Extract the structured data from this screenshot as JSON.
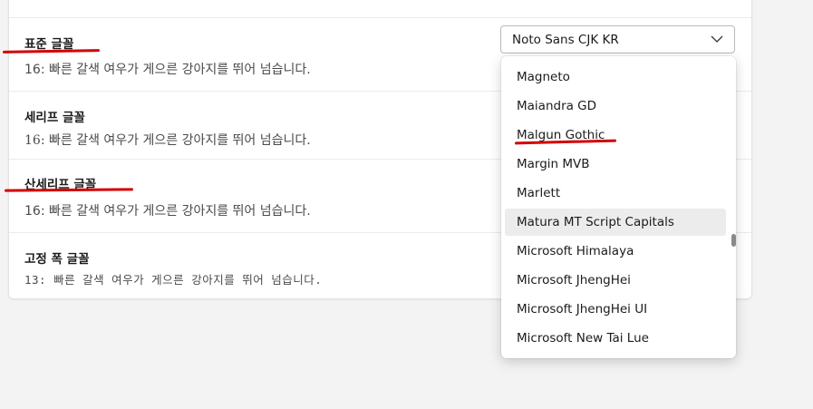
{
  "rows": [
    {
      "label": "표준 글꼴",
      "sample": "16: 빠른 갈색 여우가 게으른 강아지를 뛰어 넘습니다."
    },
    {
      "label": "세리프 글꼴",
      "sample": "16: 빠른 갈색 여우가 게으른 강아지를 뛰어 넘습니다."
    },
    {
      "label": "산세리프 글꼴",
      "sample": "16: 빠른 갈색 여우가 게으른 강아지를 뛰어 넘습니다."
    },
    {
      "label": "고정 폭 글꼴",
      "sample": "13: 빠른 갈색 여우가 게으른 강아지를 뛰어 넘습니다."
    }
  ],
  "font_select": {
    "selected": "Noto Sans CJK KR",
    "icon": "chevron-down-icon"
  },
  "dropdown": {
    "options": [
      "Magneto",
      "Maiandra GD",
      "Malgun Gothic",
      "Margin MVB",
      "Marlett",
      "Matura MT Script Capitals",
      "Microsoft Himalaya",
      "Microsoft JhengHei",
      "Microsoft JhengHei UI",
      "Microsoft New Tai Lue"
    ],
    "hovered": "Matura MT Script Capitals"
  },
  "colors": {
    "annotation": "#d40000",
    "hover": "#ececec"
  }
}
